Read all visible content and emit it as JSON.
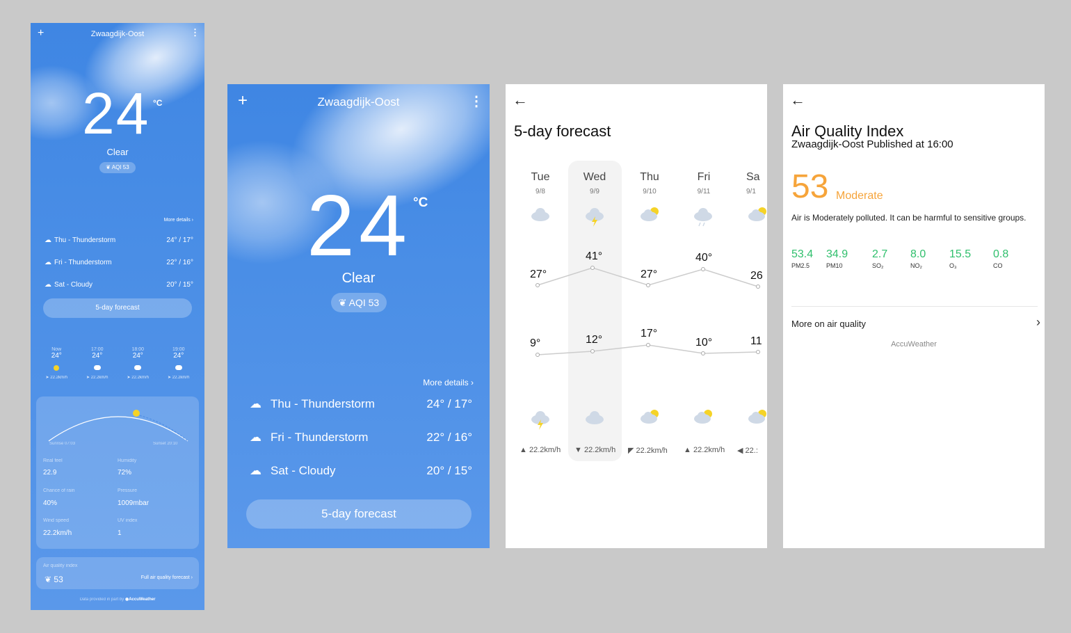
{
  "screen1": {
    "location": "Zwaagdijk-Oost",
    "temperature": "24",
    "unit": "°C",
    "condition": "Clear",
    "aqi": "AQI 53",
    "more_details": "More details",
    "forecast": [
      {
        "day": "Thu - Thunderstorm",
        "temps": "24° / 17°",
        "icon": "thunderstorm-icon"
      },
      {
        "day": "Fri - Thunderstorm",
        "temps": "22° / 16°",
        "icon": "thunderstorm-icon"
      },
      {
        "day": "Sat - Cloudy",
        "temps": "20° / 15°",
        "icon": "cloudy-icon"
      }
    ],
    "five_day_button": "5-day forecast",
    "hourly": [
      {
        "time": "Now",
        "temp": "24°",
        "wind": "22.2km/h"
      },
      {
        "time": "17:00",
        "temp": "24°",
        "wind": "22.2km/h"
      },
      {
        "time": "18:00",
        "temp": "24°",
        "wind": "22.2km/h"
      },
      {
        "time": "19:00",
        "temp": "24°",
        "wind": "22.2km/h"
      }
    ],
    "sunrise": "Sunrise 07:03",
    "sunset": "Sunset 20:10",
    "details": [
      {
        "label": "Real feel",
        "value": "22.9"
      },
      {
        "label": "Humidity",
        "value": "72%"
      },
      {
        "label": "Chance of rain",
        "value": "40%"
      },
      {
        "label": "Pressure",
        "value": "1009mbar"
      },
      {
        "label": "Wind speed",
        "value": "22.2km/h"
      },
      {
        "label": "UV index",
        "value": "1"
      }
    ],
    "aq_label": "Air quality index",
    "aq_value": "53",
    "aq_link": "Full air quality forecast",
    "footer": "Data provided in part by",
    "footer_brand": "AccuWeather"
  },
  "screen2": {
    "location": "Zwaagdijk-Oost",
    "temperature": "24",
    "unit": "°C",
    "condition": "Clear",
    "aqi": "AQI 53",
    "more_details": "More details",
    "forecast": [
      {
        "day": "Thu - Thunderstorm",
        "temps": "24° / 17°"
      },
      {
        "day": "Fri - Thunderstorm",
        "temps": "22° / 16°"
      },
      {
        "day": "Sat - Cloudy",
        "temps": "20° / 15°"
      }
    ],
    "five_day_button": "5-day forecast"
  },
  "screen3": {
    "title": "5-day forecast",
    "days": [
      {
        "day": "Tue",
        "date": "9/8",
        "high": "27°",
        "low": "9°",
        "wind": "22.2km/h"
      },
      {
        "day": "Wed",
        "date": "9/9",
        "high": "41°",
        "low": "12°",
        "wind": "22.2km/h"
      },
      {
        "day": "Thu",
        "date": "9/10",
        "high": "27°",
        "low": "17°",
        "wind": "22.2km/h"
      },
      {
        "day": "Fri",
        "date": "9/11",
        "high": "40°",
        "low": "10°",
        "wind": "22.2km/h"
      },
      {
        "day": "Sa",
        "date": "9/1",
        "high": "26",
        "low": "11",
        "wind": "22.:"
      }
    ]
  },
  "screen4": {
    "title": "Air Quality Index",
    "subtitle": "Zwaagdijk-Oost Published at 16:00",
    "value": "53",
    "level": "Moderate",
    "description": "Air is Moderately polluted. It can be harmful to sensitive groups.",
    "pollutants": [
      {
        "value": "53.4",
        "label": "PM2.5"
      },
      {
        "value": "34.9",
        "label": "PM10"
      },
      {
        "value": "2.7",
        "label": "SO₂"
      },
      {
        "value": "8.0",
        "label": "NO₂"
      },
      {
        "value": "15.5",
        "label": "O₃"
      },
      {
        "value": "0.8",
        "label": "CO"
      }
    ],
    "more": "More on air quality",
    "source": "AccuWeather"
  },
  "colors": {
    "sky": "#4a8ee6",
    "aqi_green": "#2fbf6c",
    "aqi_orange": "#f6a43a",
    "sun_yellow": "#f5d327"
  }
}
